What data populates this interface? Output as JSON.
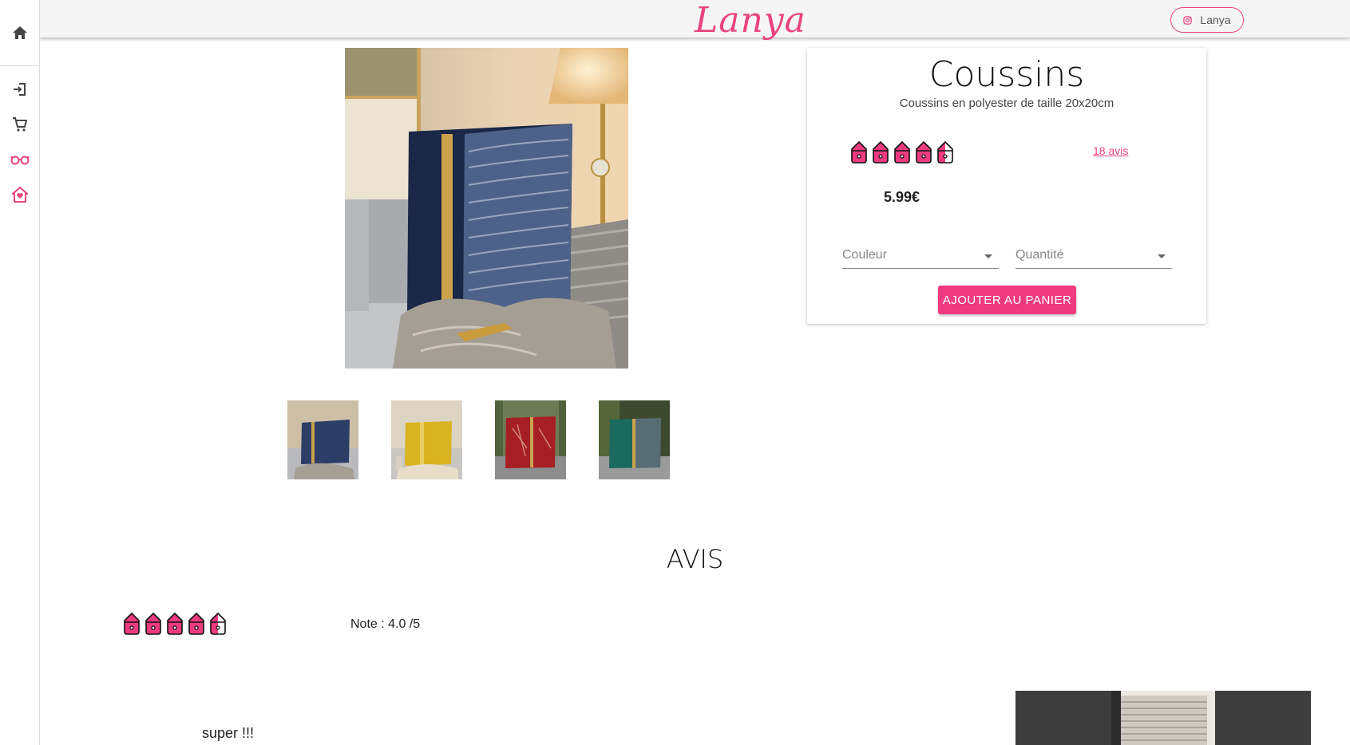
{
  "brand": {
    "logo": "Lanya",
    "instagram_label": "Lanya",
    "accent_color": "#ee3a7e"
  },
  "sidebar": {
    "icons": [
      "home-icon",
      "login-icon",
      "cart-icon",
      "glasses-icon",
      "house-heart-icon"
    ]
  },
  "product": {
    "title": "Coussins",
    "description": "Coussins en polyester de taille 20x20cm",
    "rating": 4.5,
    "reviews_link": "18 avis",
    "price": "5.99€",
    "color_placeholder": "Couleur",
    "quantity_placeholder": "Quantité",
    "add_to_cart": "AJOUTER AU PANIER",
    "thumbnails": [
      {
        "name": "navy-cushion",
        "color": "#1f3056"
      },
      {
        "name": "yellow-cushion",
        "color": "#d6b21d"
      },
      {
        "name": "red-cushion",
        "color": "#a51f24"
      },
      {
        "name": "green-cushion",
        "color": "#155f55"
      }
    ]
  },
  "reviews": {
    "section_title": "AVIS",
    "items": [
      {
        "rating": 4.5,
        "note": "Note : 4.0 /5",
        "text": "super !!!"
      }
    ]
  }
}
